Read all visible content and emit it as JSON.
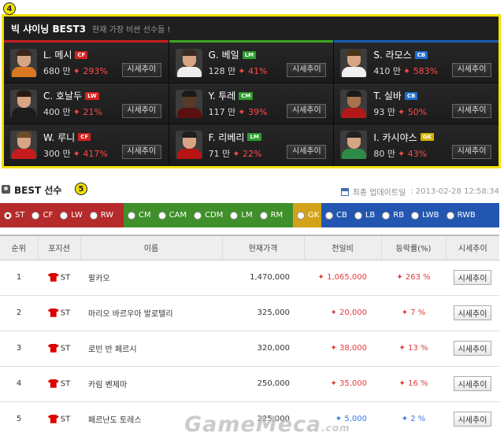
{
  "best3": {
    "badge": "4",
    "title": "빅 샤이닝 BEST3",
    "subtitle": "현재 가장 비싼 선수들 !",
    "button_label": "시세추이",
    "columns": [
      {
        "accent": "#c41f1f",
        "players": [
          {
            "name": "L. 메시",
            "pos": "CF",
            "pos_color": "#d62020",
            "price": "680 만",
            "change": "293%",
            "avatar": "messi"
          },
          {
            "name": "C. 호날두",
            "pos": "LW",
            "pos_color": "#d62020",
            "price": "400 만",
            "change": "21%",
            "avatar": "ronaldo"
          },
          {
            "name": "W. 루니",
            "pos": "CF",
            "pos_color": "#d62020",
            "price": "300 만",
            "change": "417%",
            "avatar": "rooney"
          }
        ]
      },
      {
        "accent": "#3aa525",
        "players": [
          {
            "name": "G. 베일",
            "pos": "LM",
            "pos_color": "#2e9e2e",
            "price": "128 만",
            "change": "41%",
            "avatar": "bale"
          },
          {
            "name": "Y. 투레",
            "pos": "CM",
            "pos_color": "#2e9e2e",
            "price": "117 만",
            "change": "39%",
            "avatar": "toure"
          },
          {
            "name": "F. 리베리",
            "pos": "LM",
            "pos_color": "#2e9e2e",
            "price": "71 만",
            "change": "22%",
            "avatar": "ribery"
          }
        ]
      },
      {
        "accent": "#1e5db8",
        "players": [
          {
            "name": "S. 라모스",
            "pos": "CB",
            "pos_color": "#1f6fd0",
            "price": "410 만",
            "change": "583%",
            "avatar": "ramos"
          },
          {
            "name": "T. 실바",
            "pos": "CB",
            "pos_color": "#1f6fd0",
            "price": "93 만",
            "change": "50%",
            "avatar": "silva"
          },
          {
            "name": "I. 카시야스",
            "pos": "GK",
            "pos_color": "#d8b100",
            "price": "80 만",
            "change": "43%",
            "avatar": "casillas"
          }
        ]
      }
    ]
  },
  "best_list": {
    "title": "BEST 선수",
    "badge": "5",
    "updated_label": "최종 업데이트일",
    "updated_value": ": 2013-02-28 12:58:34"
  },
  "filters": [
    {
      "bg": "#b52a2a",
      "items": [
        {
          "label": "ST",
          "selected": true
        },
        {
          "label": "CF"
        },
        {
          "label": "LW"
        },
        {
          "label": "RW"
        }
      ]
    },
    {
      "bg": "#3f8f2a",
      "items": [
        {
          "label": "CM"
        },
        {
          "label": "CAM"
        },
        {
          "label": "CDM"
        },
        {
          "label": "LM"
        },
        {
          "label": "RM"
        }
      ]
    },
    {
      "bg": "#d2a21a",
      "items": [
        {
          "label": "GK"
        }
      ]
    },
    {
      "bg": "#2356b0",
      "items": [
        {
          "label": "CB"
        },
        {
          "label": "LB"
        },
        {
          "label": "RB"
        },
        {
          "label": "LWB"
        },
        {
          "label": "RWB"
        }
      ]
    }
  ],
  "table": {
    "headers": [
      "순위",
      "포지션",
      "이름",
      "현재가격",
      "전일비",
      "등락률(%)",
      "시세추이"
    ],
    "button_label": "시세추이",
    "rows": [
      {
        "rank": "1",
        "pos": "ST",
        "name": "팔카오",
        "price": "1,470,000",
        "diff": "1,065,000",
        "rate": "263 %",
        "dir": "up"
      },
      {
        "rank": "2",
        "pos": "ST",
        "name": "마리오 바르우아 발로텔리",
        "price": "325,000",
        "diff": "20,000",
        "rate": "7 %",
        "dir": "up"
      },
      {
        "rank": "3",
        "pos": "ST",
        "name": "로빈 반 페르시",
        "price": "320,000",
        "diff": "38,000",
        "rate": "13 %",
        "dir": "up"
      },
      {
        "rank": "4",
        "pos": "ST",
        "name": "카림 벤제마",
        "price": "250,000",
        "diff": "35,000",
        "rate": "16 %",
        "dir": "up"
      },
      {
        "rank": "5",
        "pos": "ST",
        "name": "페르난도 토레스",
        "price": "225,000",
        "diff": "5,000",
        "rate": "2 %",
        "dir": "down"
      }
    ]
  },
  "watermark": {
    "main": "GameMeca",
    "suffix": ".com"
  }
}
